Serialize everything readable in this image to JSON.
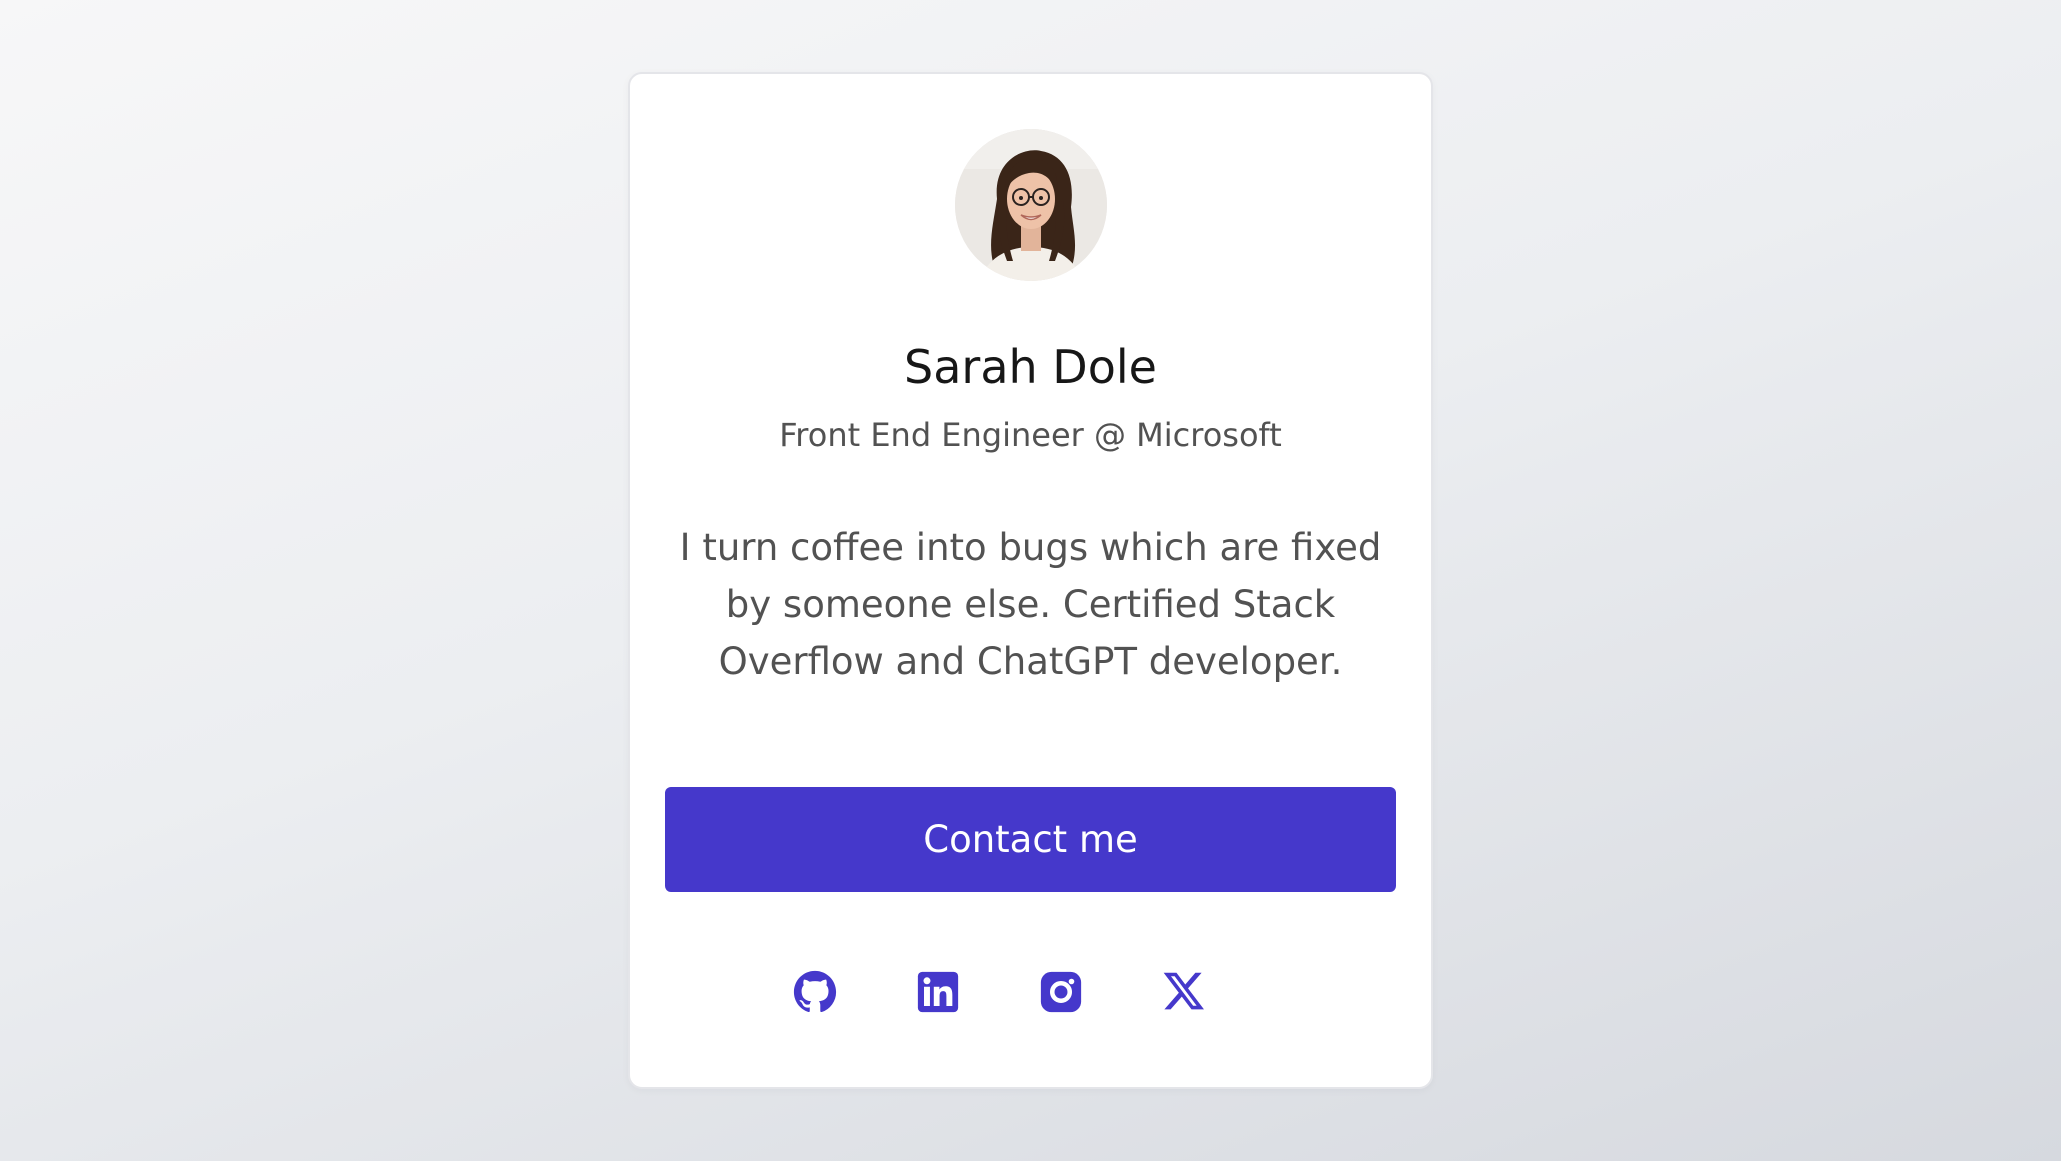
{
  "profile": {
    "name": "Sarah Dole",
    "role": "Front End Engineer @ Microsoft",
    "bio": "I turn coffee into bugs which are fixed by someone else. Certified Stack Overflow and ChatGPT developer.",
    "avatar_icon": "avatar-photo"
  },
  "contact_button": {
    "label": "Contact me"
  },
  "socials": [
    {
      "icon": "github-icon"
    },
    {
      "icon": "linkedin-icon"
    },
    {
      "icon": "instagram-icon"
    },
    {
      "icon": "x-icon"
    }
  ],
  "colors": {
    "accent": "#4538cb",
    "heading": "#171717",
    "body_text": "#525252",
    "card": "#ffffff"
  }
}
